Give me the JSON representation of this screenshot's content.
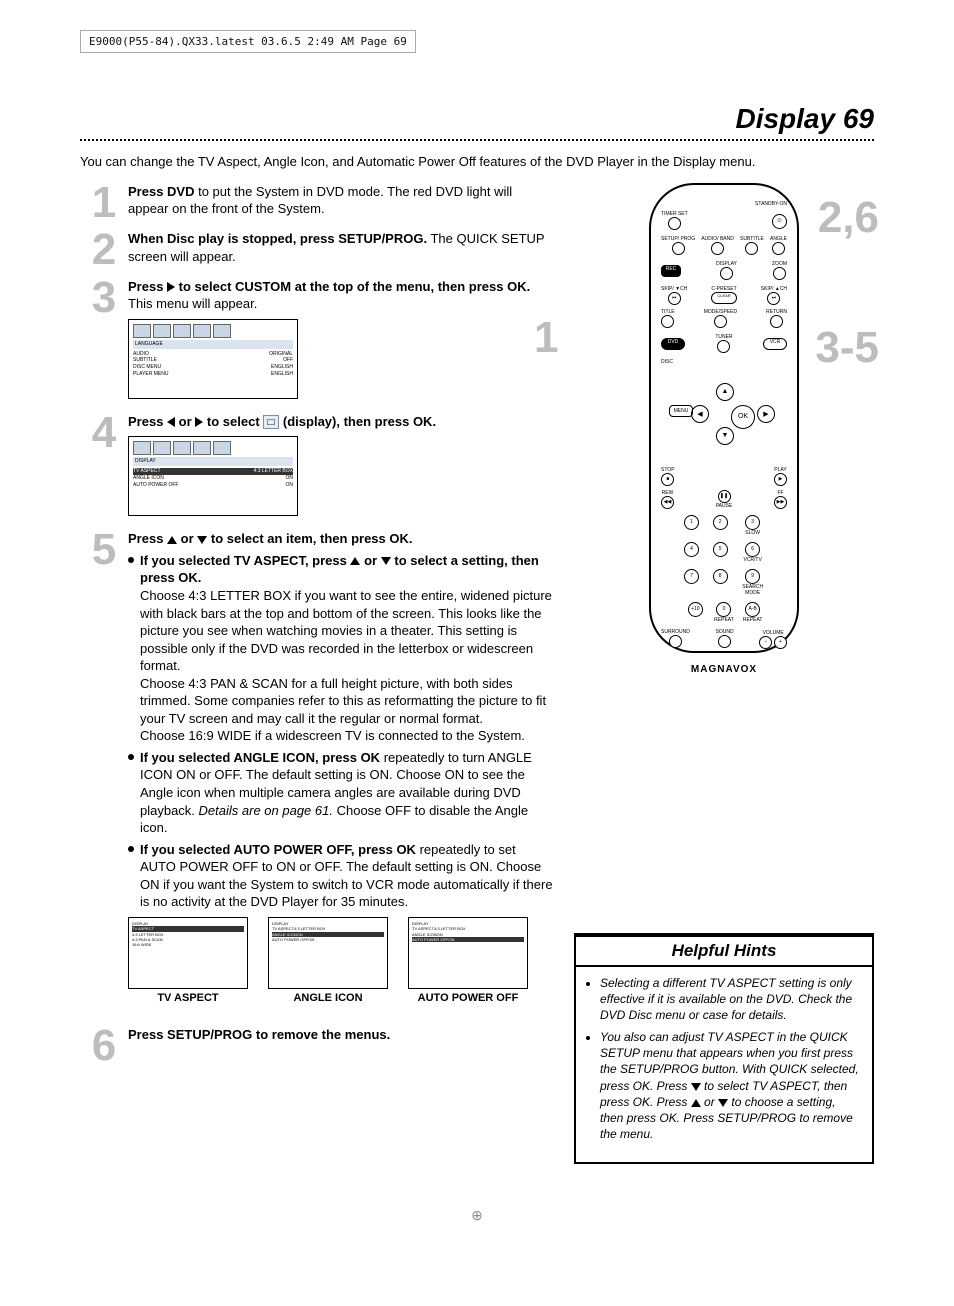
{
  "header_bar": "E9000(P55-84).QX33.latest  03.6.5 2:49 AM  Page 69",
  "page_title": "Display  69",
  "intro": "You can change the TV Aspect, Angle Icon, and Automatic Power Off features of the DVD Player in the Display menu.",
  "steps": {
    "s1": {
      "num": "1",
      "bold": "Press DVD",
      "rest": " to put the System in DVD mode. The red DVD light will appear on the front of the System."
    },
    "s2": {
      "num": "2",
      "bold": "When Disc play is stopped, press SETUP/PROG.",
      "rest": " The QUICK SETUP screen will appear."
    },
    "s3": {
      "num": "3",
      "line1_a": "Press ",
      "line1_b": " to select CUSTOM at the top of the menu, then press OK.",
      "line1_c": " This menu will appear."
    },
    "s4": {
      "num": "4",
      "line_a": "Press ",
      "line_b": " or ",
      "line_c": " to select ",
      "line_d": " (display), then press OK."
    },
    "s5": {
      "num": "5",
      "head_a": "Press ",
      "head_b": " or ",
      "head_c": " to select an item, then press OK.",
      "b1_bold": "If you selected TV ASPECT, press ",
      "b1_bold2": " or ",
      "b1_bold3": " to select a setting, then press OK.",
      "b1_p1": "Choose 4:3 LETTER BOX if you want to see the entire, widened picture with black bars at the top and bottom of the screen. This looks like the picture you see when watching movies in a theater.  This setting is possible only if the DVD was recorded in the letterbox or widescreen format.",
      "b1_p2": "Choose 4:3 PAN & SCAN for a full height picture, with both sides trimmed. Some companies refer to this as reformatting the picture to fit your TV screen and may call it the regular or normal format.",
      "b1_p3": "Choose 16:9 WIDE if a widescreen TV is connected to the System.",
      "b2_bold": "If you selected ANGLE ICON, press OK",
      "b2_rest": " repeatedly to turn ANGLE ICON ON or OFF. The default setting is ON. Choose ON to see the Angle icon when multiple camera angles are available during DVD playback. ",
      "b2_italic": "Details are on page 61.",
      "b2_tail": " Choose OFF to disable the Angle icon.",
      "b3_bold": "If you selected AUTO POWER OFF, press OK",
      "b3_rest": " repeatedly to set AUTO POWER OFF to ON or OFF. The default setting is ON. Choose ON if you want the System to switch to VCR mode automatically if there is no activity at the DVD Player for 35 minutes."
    },
    "s6": {
      "num": "6",
      "bold": "Press SETUP/PROG to remove the menus."
    }
  },
  "osd_lang": {
    "header": "LANGUAGE",
    "rows": [
      [
        "AUDIO",
        "ORIGINAL"
      ],
      [
        "SUBTITLE",
        "OFF"
      ],
      [
        "DISC MENU",
        "ENGLISH"
      ],
      [
        "PLAYER MENU",
        "ENGLISH"
      ]
    ]
  },
  "osd_display": {
    "header": "DISPLAY",
    "rows": [
      [
        "TV ASPECT",
        "4:3 LETTER BOX"
      ],
      [
        "ANGLE ICON",
        "ON"
      ],
      [
        "AUTO POWER OFF",
        "ON"
      ]
    ]
  },
  "osd_tvaspect": {
    "header": "DISPLAY",
    "highlight": "TV ASPECT",
    "rows": [
      [
        "4:3 LETTER BOX",
        ""
      ],
      [
        "4:3 PAN & SCAN",
        ""
      ],
      [
        "16:9 WIDE",
        ""
      ]
    ]
  },
  "mini_captions": {
    "c1": "TV ASPECT",
    "c2": "ANGLE ICON",
    "c3": "AUTO POWER OFF"
  },
  "remote": {
    "standby": "STANDBY-ON",
    "timer": "TIMER SET",
    "setup": "SETUP/\nPROG",
    "audio": "AUDIO/\nBAND",
    "subtitle": "SUBTITLE",
    "angle": "ANGLE",
    "rec": "REC",
    "display": "DISPLAY",
    "zoom": "ZOOM",
    "skip_l": "SKIP/\n▼CH",
    "skip_r": "SKIP/\n▲CH",
    "clear": "CLEAR",
    "cpreset": "C-PRESET",
    "title": "TITLE",
    "modespeed": "MODE/SPEED",
    "return": "RETURN",
    "dvd": "DVD",
    "tuner": "TUNER",
    "vcr": "VCR",
    "disc": "DISC",
    "menu": "MENU",
    "ok": "OK",
    "stop": "STOP",
    "play": "PLAY",
    "rew": "REW",
    "pause": "PAUSE",
    "ff": "FF",
    "slow": "SLOW",
    "vcrtv": "VCR/TV",
    "search": "SEARCH MODE",
    "repeat1": "REPEAT",
    "repeat2": "REPEAT",
    "ab": "A-B",
    "plus10": "+10",
    "surround": "SURROUND",
    "sound": "SOUND",
    "volume": "VOLUME",
    "brand": "MAGNAVOX",
    "nums": [
      "1",
      "2",
      "3",
      "4",
      "5",
      "6",
      "7",
      "8",
      "9",
      "",
      "0",
      ""
    ]
  },
  "callouts": {
    "c1": "1",
    "c26": "2,6",
    "c35": "3-5"
  },
  "hints": {
    "title": "Helpful Hints",
    "h1": "Selecting a different TV ASPECT setting is only effective if it is available on the DVD. Check the DVD Disc menu or case for details.",
    "h2_a": "You also can adjust TV ASPECT in the QUICK SETUP menu that appears when you first press the SETUP/PROG button. With QUICK selected, press OK. Press ",
    "h2_b": " to select TV ASPECT, then press OK. Press ",
    "h2_c": " or ",
    "h2_d": " to choose a setting, then press OK. Press SETUP/PROG to remove the menu."
  }
}
